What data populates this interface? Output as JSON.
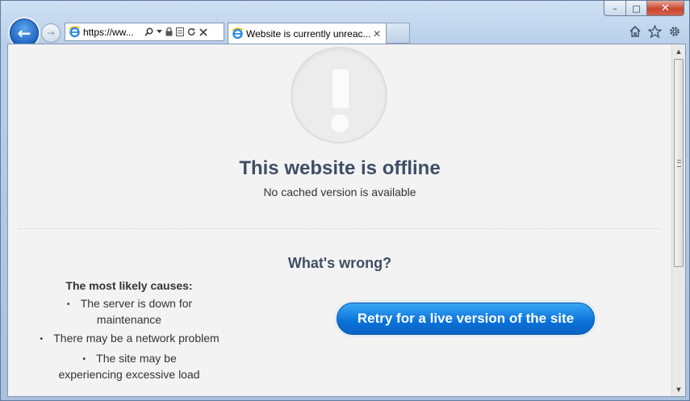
{
  "browser": {
    "address_url": "https://ww...",
    "tab_title": "Website is currently unreac...",
    "tab_close": "✕",
    "back_glyph": "←",
    "forward_glyph": "→",
    "caption": {
      "minimize": "–",
      "maximize": "□",
      "close": "✕"
    },
    "icons": [
      "ie-logo-icon",
      "search-icon",
      "dropdown-icon",
      "lock-icon",
      "compat-view-icon",
      "refresh-icon",
      "stop-icon",
      "home-icon",
      "favorites-star-icon",
      "settings-gear-icon"
    ],
    "accent_color": "#1f63c2"
  },
  "page": {
    "title": "This website is offline",
    "subtitle": "No cached version is available",
    "wrong_heading": "What's wrong?",
    "causes_heading": "The most likely causes:",
    "causes": [
      "The server is down for maintenance",
      "There may be a network problem",
      "The site may be experiencing excessive load"
    ],
    "retry_label": "Retry for a live version of the site",
    "retry_color": "#0a71d8",
    "heading_color": "#3e4f66"
  }
}
